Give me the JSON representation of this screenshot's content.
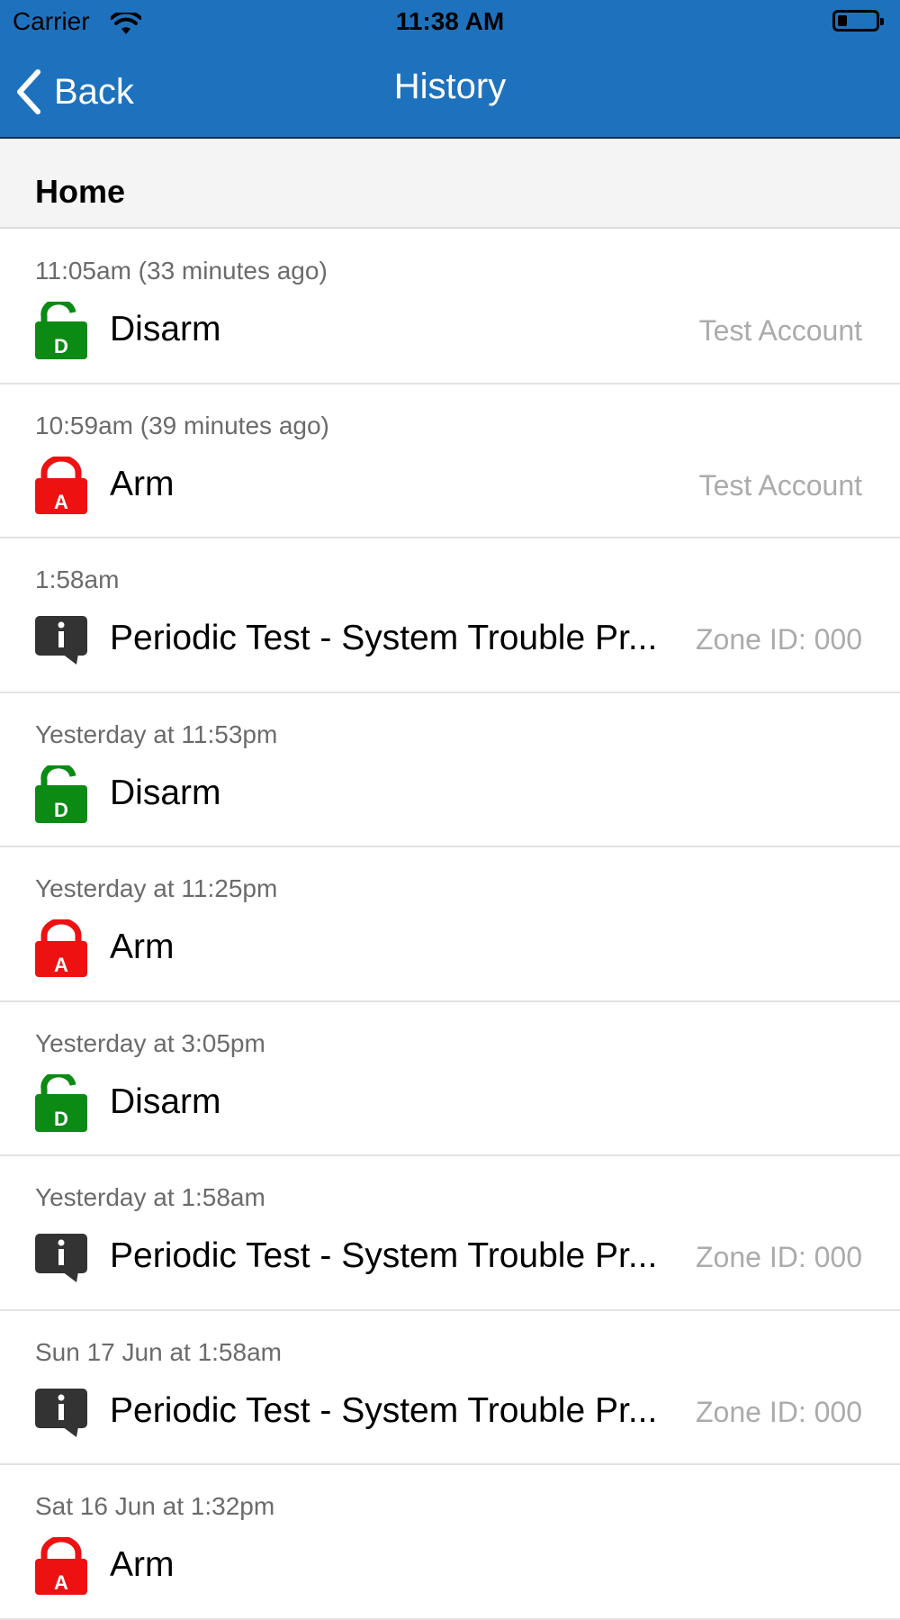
{
  "status_bar": {
    "carrier": "Carrier",
    "time": "11:38 AM"
  },
  "nav": {
    "back_label": "Back",
    "title": "History"
  },
  "section": {
    "title": "Home"
  },
  "colors": {
    "nav_blue": "#1e72bd",
    "disarm_green": "#0b8a14",
    "arm_red": "#ee1111",
    "info_dark": "#333333"
  },
  "events": [
    {
      "time": "11:05am (33 minutes ago)",
      "label": "Disarm",
      "right": "Test Account",
      "icon": "disarm-lock-icon"
    },
    {
      "time": "10:59am (39 minutes ago)",
      "label": "Arm",
      "right": "Test Account",
      "icon": "arm-lock-icon"
    },
    {
      "time": "1:58am",
      "label": "Periodic Test - System Trouble Pr...",
      "right": "Zone ID: 000",
      "icon": "info-icon"
    },
    {
      "time": "Yesterday at 11:53pm",
      "label": "Disarm",
      "right": "",
      "icon": "disarm-lock-icon"
    },
    {
      "time": "Yesterday at 11:25pm",
      "label": "Arm",
      "right": "",
      "icon": "arm-lock-icon"
    },
    {
      "time": "Yesterday at 3:05pm",
      "label": "Disarm",
      "right": "",
      "icon": "disarm-lock-icon"
    },
    {
      "time": "Yesterday at 1:58am",
      "label": "Periodic Test - System Trouble Pr...",
      "right": "Zone ID: 000",
      "icon": "info-icon"
    },
    {
      "time": "Sun 17 Jun at 1:58am",
      "label": "Periodic Test - System Trouble Pr...",
      "right": "Zone ID: 000",
      "icon": "info-icon"
    },
    {
      "time": "Sat 16 Jun at 1:32pm",
      "label": "Arm",
      "right": "",
      "icon": "arm-lock-icon"
    }
  ]
}
